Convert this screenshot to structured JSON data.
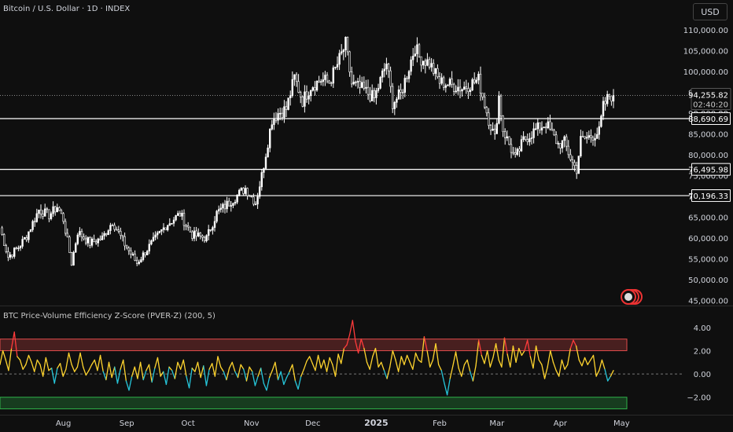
{
  "header": {
    "symbol_title": "Bitcoin / U.S. Dollar · 1D · INDEX",
    "currency_button": "USD"
  },
  "colors": {
    "background": "#0f0f0f",
    "candle": "#ffffff",
    "level_line": "#ffffff",
    "overbought_band": "#e04b4b",
    "oversold_band": "#2fb24a",
    "zscore_high": "#ffd42e",
    "zscore_low": "#26c6da",
    "zscore_extreme": "#ff3b3b"
  },
  "chart_data": [
    {
      "type": "candlestick",
      "title": "Bitcoin / U.S. Dollar · 1D · INDEX",
      "x_ticks": [
        "Aug",
        "Sep",
        "Oct",
        "Nov",
        "Dec",
        "2025",
        "Feb",
        "Mar",
        "Apr",
        "May"
      ],
      "x_range": [
        "2024-07-01",
        "2025-05-01"
      ],
      "y_ticks": [
        110000,
        105000,
        100000,
        95000,
        90000,
        85000,
        80000,
        75000,
        70000,
        65000,
        60000,
        55000,
        50000,
        45000
      ],
      "y_tick_labels": [
        "110,000.00",
        "105,000.00",
        "100,000.00",
        "95,000.00",
        "90,000.00",
        "85,000.00",
        "80,000.00",
        "75,000.00",
        "70,000.00",
        "65,000.00",
        "60,000.00",
        "55,000.00",
        "50,000.00",
        "45,000.00"
      ],
      "ylim": [
        44000,
        111500
      ],
      "close_path": [
        [
          "2024-07-01",
          62500
        ],
        [
          "2024-07-05",
          55500
        ],
        [
          "2024-07-10",
          57800
        ],
        [
          "2024-07-14",
          60500
        ],
        [
          "2024-07-20",
          66800
        ],
        [
          "2024-07-25",
          65500
        ],
        [
          "2024-07-29",
          67500
        ],
        [
          "2024-08-01",
          64500
        ],
        [
          "2024-08-05",
          54000
        ],
        [
          "2024-08-08",
          61500
        ],
        [
          "2024-08-14",
          58800
        ],
        [
          "2024-08-20",
          60000
        ],
        [
          "2024-08-25",
          64000
        ],
        [
          "2024-08-31",
          58500
        ],
        [
          "2024-09-06",
          54000
        ],
        [
          "2024-09-12",
          58000
        ],
        [
          "2024-09-20",
          63000
        ],
        [
          "2024-09-27",
          65800
        ],
        [
          "2024-10-03",
          60800
        ],
        [
          "2024-10-10",
          60000
        ],
        [
          "2024-10-15",
          66000
        ],
        [
          "2024-10-21",
          68500
        ],
        [
          "2024-10-29",
          72000
        ],
        [
          "2024-11-03",
          68500
        ],
        [
          "2024-11-06",
          75000
        ],
        [
          "2024-11-11",
          88500
        ],
        [
          "2024-11-14",
          90000
        ],
        [
          "2024-11-18",
          91000
        ],
        [
          "2024-11-22",
          98500
        ],
        [
          "2024-11-26",
          93000
        ],
        [
          "2024-11-30",
          96500
        ],
        [
          "2024-12-05",
          98000
        ],
        [
          "2024-12-09",
          97500
        ],
        [
          "2024-12-12",
          100500
        ],
        [
          "2024-12-17",
          106500
        ],
        [
          "2024-12-20",
          97000
        ],
        [
          "2024-12-26",
          95500
        ],
        [
          "2024-12-31",
          93500
        ],
        [
          "2025-01-06",
          102000
        ],
        [
          "2025-01-09",
          92500
        ],
        [
          "2025-01-13",
          94500
        ],
        [
          "2025-01-20",
          106000
        ],
        [
          "2025-01-22",
          103500
        ],
        [
          "2025-01-27",
          102000
        ],
        [
          "2025-02-01",
          97500
        ],
        [
          "2025-02-05",
          97000
        ],
        [
          "2025-02-12",
          96000
        ],
        [
          "2025-02-20",
          98000
        ],
        [
          "2025-02-25",
          88500
        ],
        [
          "2025-02-28",
          84000
        ],
        [
          "2025-03-02",
          94000
        ],
        [
          "2025-03-04",
          86000
        ],
        [
          "2025-03-10",
          79000
        ],
        [
          "2025-03-14",
          83500
        ],
        [
          "2025-03-20",
          86000
        ],
        [
          "2025-03-25",
          87500
        ],
        [
          "2025-03-31",
          82500
        ],
        [
          "2025-04-03",
          83000
        ],
        [
          "2025-04-07",
          78000
        ],
        [
          "2025-04-09",
          76500
        ],
        [
          "2025-04-11",
          83500
        ],
        [
          "2025-04-16",
          84500
        ],
        [
          "2025-04-20",
          85500
        ],
        [
          "2025-04-22",
          91500
        ],
        [
          "2025-04-25",
          94200
        ],
        [
          "2025-04-27",
          94255.82
        ]
      ],
      "horizontal_levels": [
        {
          "label": "88,690.69",
          "value": 88690.69
        },
        {
          "label": "76,495.98",
          "value": 76495.98
        },
        {
          "label": "70,196.33",
          "value": 70196.33
        }
      ],
      "last_price": {
        "value_label": "94,255.82",
        "value": 94255.82,
        "countdown": "02:40:20"
      }
    },
    {
      "type": "line",
      "title": "BTC Price-Volume Efficiency Z-Score (PVER-Z) (200, 5)",
      "y_ticks": [
        4.0,
        2.0,
        0.0,
        -2.0
      ],
      "y_tick_labels": [
        "4.00",
        "2.00",
        "0.00",
        "−2.00"
      ],
      "ylim": [
        -3.3,
        4.8
      ],
      "overbought_band": [
        2.0,
        3.0
      ],
      "oversold_band": [
        -3.0,
        -2.0
      ],
      "zero_line": 0,
      "series": [
        {
          "values": [
            0.8,
            2.0,
            1.2,
            0.3,
            2.2,
            3.6,
            1.5,
            1.2,
            0.4,
            0.8,
            1.6,
            1.0,
            0.2,
            1.2,
            0.8,
            -0.2,
            1.4,
            0.3,
            0.5,
            -0.8,
            0.5,
            0.9,
            -0.2,
            0.4,
            1.8,
            0.8,
            0.2,
            0.6,
            1.8,
            0.6,
            -0.1,
            0.3,
            0.8,
            1.2,
            0.3,
            1.6,
            0.2,
            -0.5,
            1.0,
            -0.3,
            0.6,
            -0.8,
            0.4,
            1.2,
            -0.6,
            -1.4,
            -0.2,
            0.6,
            -0.4,
            1.0,
            -0.5,
            0.3,
            0.8,
            -0.7,
            0.5,
            1.4,
            -0.2,
            0.2,
            -0.9,
            0.6,
            0.3,
            -0.4,
            1.0,
            0.4,
            1.2,
            -0.2,
            -1.2,
            0.5,
            0.2,
            1.0,
            -0.3,
            0.7,
            -1.0,
            0.4,
            0.9,
            -0.2,
            1.5,
            0.6,
            0.2,
            -0.5,
            0.5,
            1.0,
            0.2,
            -0.3,
            0.8,
            0.4,
            -0.6,
            0.6,
            0.2,
            -1.0,
            -0.2,
            0.5,
            -0.8,
            -1.4,
            -0.3,
            0.3,
            1.0,
            -0.5,
            0.2,
            -0.9,
            -0.3,
            0.2,
            0.8,
            -0.6,
            -1.3,
            -0.2,
            0.4,
            1.1,
            1.5,
            0.9,
            0.3,
            1.6,
            0.5,
            1.2,
            0.2,
            1.4,
            0.8,
            -0.2,
            1.7,
            0.9,
            2.2,
            2.5,
            3.4,
            4.6,
            2.8,
            1.8,
            3.0,
            2.2,
            1.0,
            0.4,
            1.5,
            2.2,
            0.6,
            1.0,
            0.3,
            -0.4,
            0.6,
            2.0,
            1.2,
            0.2,
            1.5,
            0.8,
            1.6,
            1.0,
            0.4,
            1.8,
            1.2,
            1.0,
            3.2,
            2.0,
            0.6,
            1.2,
            2.6,
            0.8,
            0.3,
            -0.8,
            -1.8,
            -0.4,
            0.7,
            1.9,
            0.5,
            -0.2,
            0.8,
            1.2,
            0.2,
            -0.6,
            0.7,
            2.9,
            1.6,
            0.9,
            2.0,
            0.6,
            1.4,
            2.6,
            1.2,
            0.6,
            3.1,
            1.7,
            0.6,
            2.4,
            1.0,
            2.2,
            1.6,
            2.0,
            2.9,
            1.5,
            0.5,
            2.4,
            1.2,
            0.8,
            -0.4,
            0.6,
            2.0,
            1.0,
            0.3,
            -0.2,
            1.2,
            0.4,
            0.8,
            2.2,
            2.9,
            2.4,
            1.2,
            0.7,
            1.4,
            0.8,
            1.2,
            1.6,
            -0.2,
            0.3,
            1.2,
            0.4,
            -0.6,
            -0.2,
            0.3
          ],
          "x_start": "2024-07-01",
          "x_end": "2025-04-27"
        }
      ]
    }
  ]
}
